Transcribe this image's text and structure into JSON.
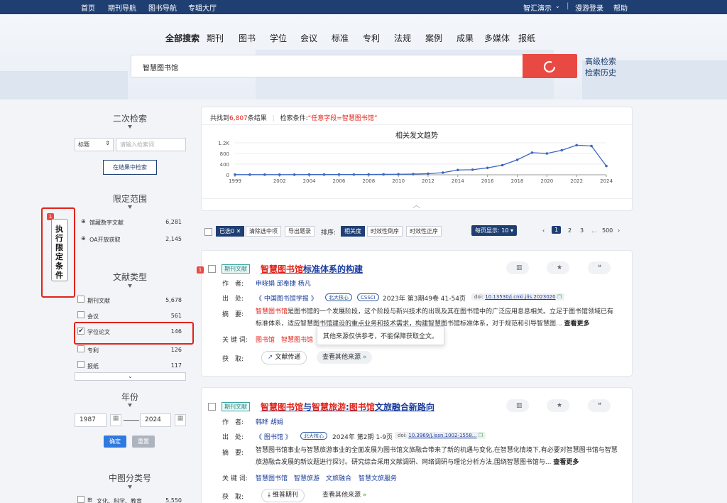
{
  "topbar": {
    "home": "首页",
    "journal_nav": "期刊导航",
    "book_nav": "图书导航",
    "special": "专辑大厅",
    "org": "智汇演示",
    "login": "漫游登录",
    "help": "帮助"
  },
  "scopes": [
    "全部搜索",
    "期刊",
    "图书",
    "学位",
    "会议",
    "标准",
    "专利",
    "法规",
    "案例",
    "成果",
    "多媒体",
    "报纸"
  ],
  "search": {
    "value": "智慧图书馆",
    "advanced": "高级检索",
    "history": "检索历史"
  },
  "sidebar": {
    "secondary_title": "二次检索",
    "field_select": "标题",
    "field_placeholder": "请输入检索词",
    "search_in_results": "在结果中检索",
    "scope_title": "限定范围",
    "scope_items": [
      {
        "label": "馆藏数字文献",
        "count": "6,281"
      },
      {
        "label": "OA开放获取",
        "count": "2,145"
      }
    ],
    "execute_label": "执行限定条件",
    "execute_badge": "1",
    "doctype_title": "文献类型",
    "doctype_items": [
      {
        "label": "期刊文献",
        "count": "5,678"
      },
      {
        "label": "会议",
        "count": "561"
      },
      {
        "label": "学位论文",
        "count": "146",
        "checked": true
      },
      {
        "label": "专利",
        "count": "126"
      },
      {
        "label": "报纸",
        "count": "117"
      }
    ],
    "year_title": "年份",
    "year_from": "1987",
    "year_to": "2024",
    "confirm": "确定",
    "reset": "重置",
    "clc_title": "中图分类号",
    "clc_first": {
      "label": "文化、科学、教育",
      "count": "5,550"
    }
  },
  "summary": {
    "prefix": "共找到",
    "count": "6,807",
    "suffix": "条结果",
    "cond_label": "检索条件:",
    "cond_value": "“任意字段=智慧图书馆”"
  },
  "chart_data": {
    "type": "line",
    "title": "相关发文趋势",
    "x": [
      1999,
      2000,
      2001,
      2002,
      2003,
      2004,
      2005,
      2006,
      2007,
      2008,
      2009,
      2010,
      2011,
      2012,
      2013,
      2014,
      2015,
      2016,
      2017,
      2018,
      2019,
      2020,
      2021,
      2022,
      2023,
      2024
    ],
    "values": [
      5,
      5,
      5,
      5,
      5,
      8,
      8,
      10,
      10,
      12,
      15,
      20,
      25,
      40,
      80,
      180,
      190,
      260,
      360,
      560,
      830,
      800,
      920,
      1110,
      1080,
      330
    ],
    "xticks": [
      "1999",
      "2002",
      "2004",
      "2006",
      "2008",
      "2010",
      "2012",
      "2014",
      "2016",
      "2018",
      "2020",
      "2022",
      "2024"
    ],
    "yticks": [
      "0",
      "400",
      "800",
      "1.2K"
    ],
    "ylim": [
      0,
      1200
    ],
    "color": "#3b66c4"
  },
  "toolbar": {
    "selected": "已选0",
    "clear": "清除选中项",
    "export": "导出题录",
    "sort_label": "排序:",
    "sort_relevance": "相关度",
    "sort_time_desc": "时效性倒序",
    "sort_time_asc": "时效性正序",
    "per_page": "每页显示: 10",
    "pages": [
      "1",
      "2",
      "3",
      "...",
      "500"
    ]
  },
  "results": [
    {
      "type": "期刊文献",
      "badge": "1",
      "title_hl": "智慧图书馆",
      "title_rest": "标准体系的构建",
      "authors": "申晓娟 邱奉捷 杨凡",
      "source": "《 中国图书馆学报 》",
      "cores": [
        "北大核心",
        "CSSCI"
      ],
      "issue": "2023年 第3期49卷 41-54页",
      "doi_label": "doi:",
      "doi": "10.13530/j.cnki.jlis.2023020",
      "abstract": "是图书馆的一个发展阶段，这个阶段与新兴技术的出现及其在图书馆中的广泛应用息息相关。立足于图书馆领域已有标准体系，适应智慧图书馆建设的重点业务和技术需求，构建智慧图书馆标准体系，对于规范和引导智慧图...",
      "abstract_hl": "智慧图书馆",
      "more": "查看更多",
      "keywords": [
        "图书馆",
        "智慧图书馆"
      ],
      "get": "获　取:",
      "btn1": "文献传递",
      "btn2": "查看其他来源",
      "tooltip": "其他来源仅供参考，不能保障获取全文。"
    },
    {
      "type": "期刊文献",
      "title_parts": [
        "智慧图书馆",
        "与",
        "智慧旅游",
        ":",
        "图书馆",
        "文旅融合新路向"
      ],
      "authors": "韩晔 胡娟",
      "source": "《 图书馆 》",
      "cores": [
        "北大核心"
      ],
      "issue": "2024年 第2期 1-9页",
      "doi_label": "doi:",
      "doi": "10.3969/j.issn.1002-1558...",
      "abstract": "智慧图书馆事业与智慧旅游事业的全面发展为图书馆文旅融合带来了新的机遇与变化,在智慧化情境下,有必要对智慧图书馆与智慧旅游融合发展的新议题进行探讨。研究综合采用文献调研、网络调研与理论分析方法,围绕智慧图书馆与...",
      "more": "查看更多",
      "keywords": [
        "智慧图书馆",
        "智慧旅游",
        "文旅融合",
        "智慧文旅服务"
      ],
      "get": "获　取:",
      "btn1": "维普期刊",
      "btn2": "查看其他来源"
    }
  ],
  "labels": {
    "author": "作　者:",
    "source": "出　处:",
    "abstract": "摘　要:",
    "keywords": "关 键 词:"
  },
  "actions": {
    "album": "专辑",
    "collect": "收藏",
    "cite": "引用"
  }
}
